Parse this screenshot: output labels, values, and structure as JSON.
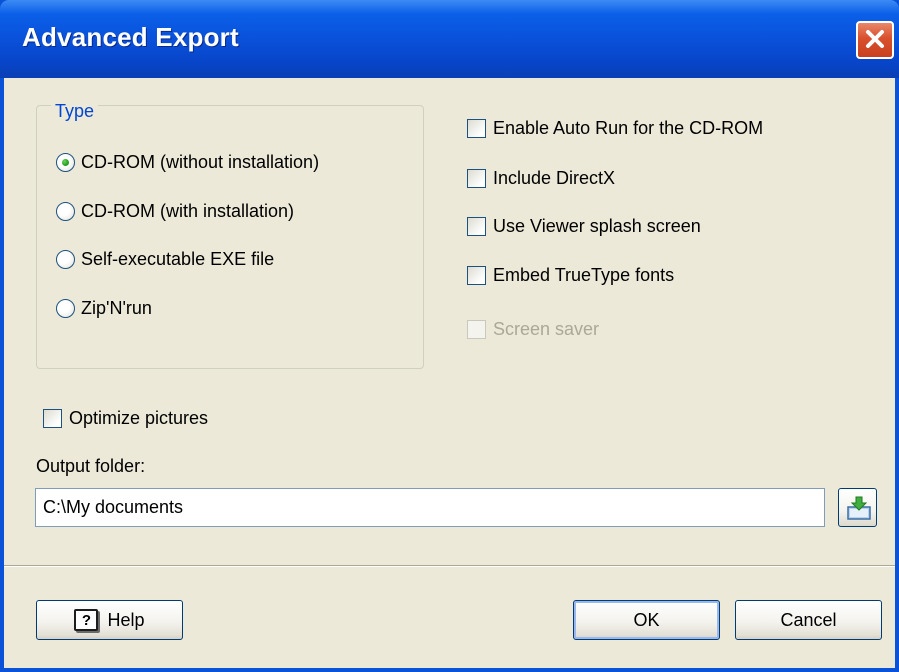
{
  "window": {
    "title": "Advanced Export",
    "close_icon": "close-icon"
  },
  "type_group": {
    "legend": "Type",
    "selected": "cd_rom_without_installation",
    "options": [
      {
        "label": "CD-ROM (without installation)",
        "checked": true
      },
      {
        "label": "CD-ROM (with installation)",
        "checked": false
      },
      {
        "label": "Self-executable EXE file",
        "checked": false
      },
      {
        "label": "Zip'N'run",
        "checked": false
      }
    ]
  },
  "checkboxes": [
    {
      "label": "Enable Auto Run for the CD-ROM",
      "checked": false,
      "enabled": true
    },
    {
      "label": "Include DirectX",
      "checked": false,
      "enabled": true
    },
    {
      "label": "Use Viewer splash screen",
      "checked": false,
      "enabled": true
    },
    {
      "label": "Embed TrueType fonts",
      "checked": false,
      "enabled": true
    },
    {
      "label": "Screen saver",
      "checked": false,
      "enabled": false
    }
  ],
  "optimize": {
    "label": "Optimize pictures",
    "checked": false
  },
  "output": {
    "label": "Output folder:",
    "value": "C:\\My documents",
    "browse_icon": "folder-download-icon"
  },
  "footer": {
    "help_label": "Help",
    "help_icon_glyph": "?",
    "ok_label": "OK",
    "cancel_label": "Cancel"
  },
  "colors": {
    "title_bar": "#0a4fd8",
    "group_legend": "#0046d5",
    "dialog_face": "#ece9d8",
    "close_button": "#d9502d"
  }
}
